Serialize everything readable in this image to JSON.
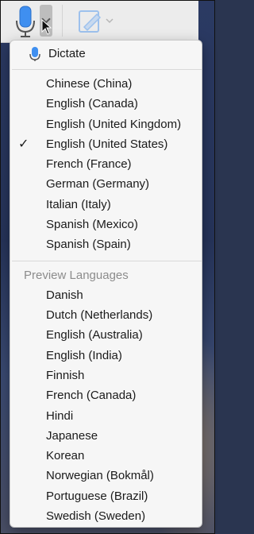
{
  "toolbar": {
    "dictation_button_icon": "microphone-icon",
    "dictation_menu_chevron_icon": "chevron-down-icon",
    "markup_button_icon": "pen-markup-icon"
  },
  "menu": {
    "dictate_label": "Dictate",
    "dictate_icon": "microphone-icon",
    "languages": [
      {
        "label": "Chinese (China)",
        "checked": false
      },
      {
        "label": "English (Canada)",
        "checked": false
      },
      {
        "label": "English (United Kingdom)",
        "checked": false
      },
      {
        "label": "English (United States)",
        "checked": true
      },
      {
        "label": "French (France)",
        "checked": false
      },
      {
        "label": "German (Germany)",
        "checked": false
      },
      {
        "label": "Italian (Italy)",
        "checked": false
      },
      {
        "label": "Spanish (Mexico)",
        "checked": false
      },
      {
        "label": "Spanish (Spain)",
        "checked": false
      }
    ],
    "check_mark": "✓",
    "preview_header": "Preview Languages",
    "preview_languages": [
      "Danish",
      "Dutch (Netherlands)",
      "English (Australia)",
      "English (India)",
      "Finnish",
      "French (Canada)",
      "Hindi",
      "Japanese",
      "Korean",
      "Norwegian (Bokmål)",
      "Portuguese (Brazil)",
      "Swedish (Sweden)"
    ]
  },
  "colors": {
    "accent_blue": "#3f8ff0",
    "menu_background": "#f6f6f6",
    "header_gray": "#8c8c8c"
  }
}
